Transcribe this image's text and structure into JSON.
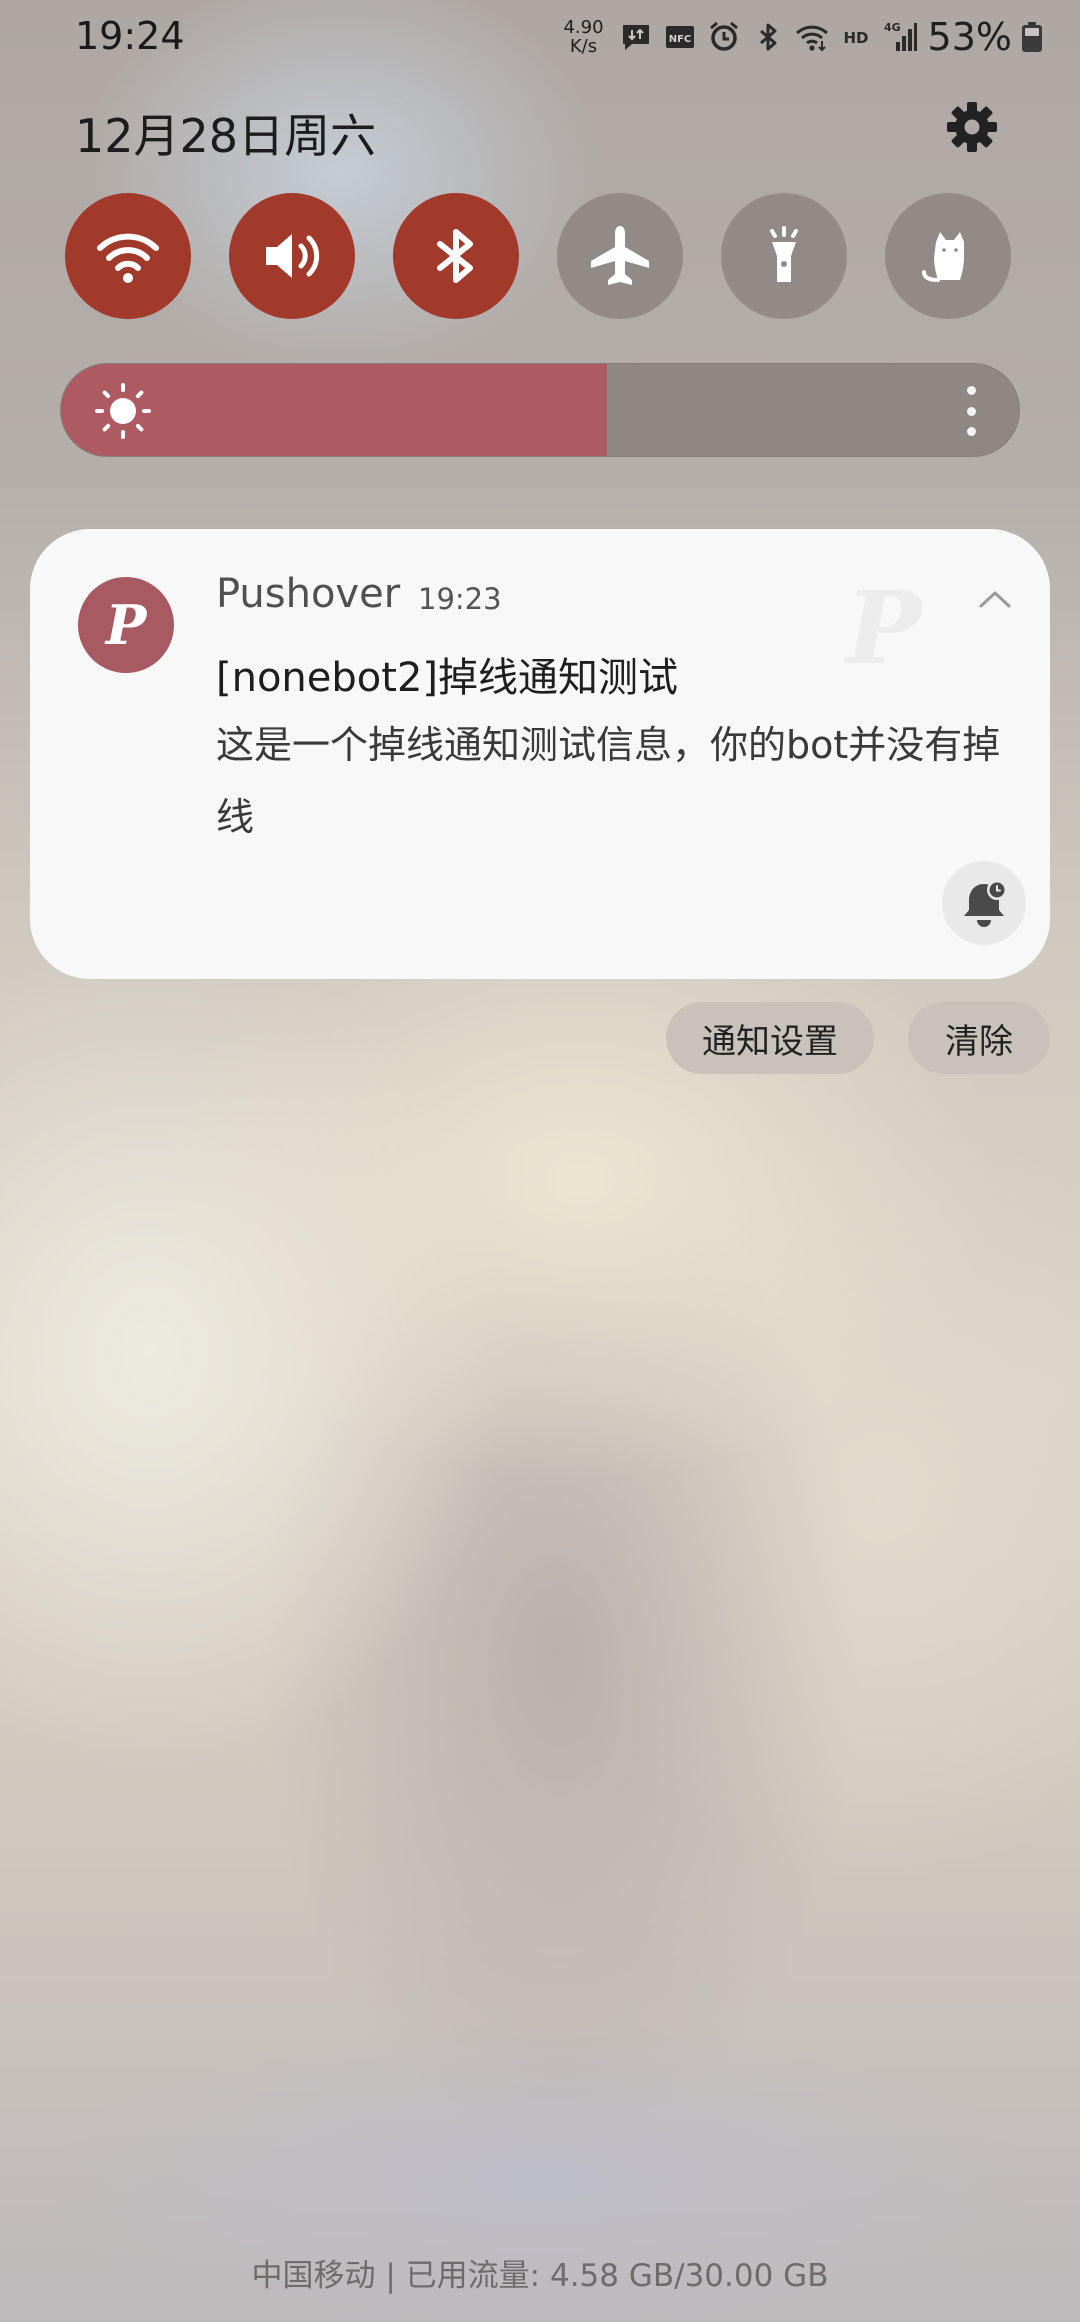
{
  "status_bar": {
    "time": "19:24",
    "net_speed_value": "4.90",
    "net_speed_unit": "K/s",
    "icons": [
      "message-icon",
      "nfc-icon",
      "alarm-icon",
      "bluetooth-icon",
      "wifi-icon",
      "hd-icon",
      "signal-4g-icon"
    ],
    "hd_label": "HD",
    "network_type": "4G",
    "nfc_label": "NFC",
    "battery_percent": "53%"
  },
  "header": {
    "date": "12月28日周六"
  },
  "quick_tiles": [
    {
      "name": "wifi",
      "icon": "wifi-icon",
      "active": true
    },
    {
      "name": "sound",
      "icon": "volume-icon",
      "active": true
    },
    {
      "name": "bluetooth",
      "icon": "bluetooth-icon",
      "active": true
    },
    {
      "name": "airplane",
      "icon": "airplane-icon",
      "active": false
    },
    {
      "name": "flashlight",
      "icon": "flashlight-icon",
      "active": false
    },
    {
      "name": "cat",
      "icon": "cat-icon",
      "active": false
    }
  ],
  "brightness": {
    "level": 0.57
  },
  "notification": {
    "app_icon_letter": "P",
    "app_name": "Pushover",
    "time": "19:23",
    "title": "[nonebot2]掉线通知测试",
    "body": "这是一个掉线通知测试信息，你的bot并没有掉线"
  },
  "actions": {
    "settings_label": "通知设置",
    "clear_label": "清除"
  },
  "footer": {
    "carrier_info": "中国移动 | 已用流量: 4.58 GB/30.00 GB"
  },
  "colors": {
    "tile_active": "#a23a2b",
    "tile_inactive": "#928a86",
    "brightness_fill": "#ad5a62",
    "app_icon_bg": "#a85a63"
  }
}
